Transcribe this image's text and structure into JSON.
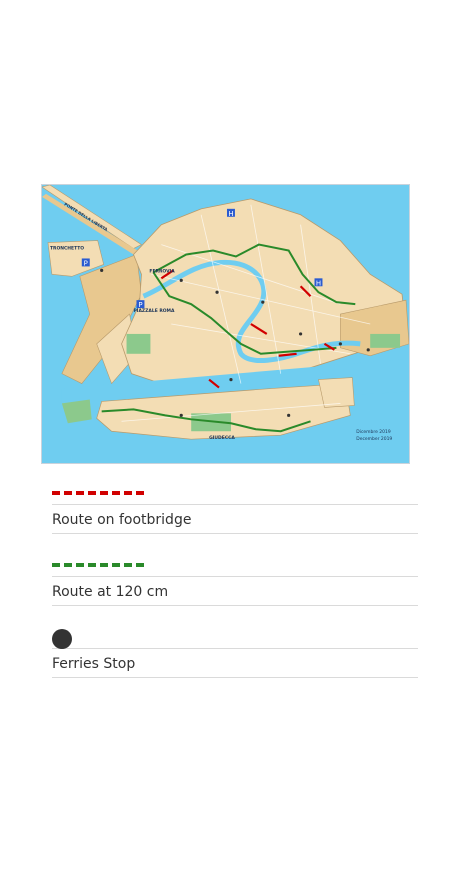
{
  "map": {
    "labels": {
      "tronchetto": "TRONCHETTO",
      "ferrovia": "FERROVIA",
      "piazzale_roma": "PIAZZALE ROMA",
      "giudecca": "GIUDECCA",
      "ponte": "PONTE DELLA LIBERTÀ",
      "date_it": "Dicembre 2019",
      "date_en": "December 2019",
      "parking_a": "P",
      "parking_b": "P",
      "h_a": "H",
      "h_b": "H"
    },
    "colors": {
      "water": "#6fcdf0",
      "land": "#f3ddb4",
      "land_dark": "#e8c88f",
      "park": "#8cc98c",
      "route_footbridge": "#d10000",
      "route_120": "#2a8a2a",
      "ferry_stop": "#333333"
    }
  },
  "legend": {
    "items": [
      {
        "label": "Route on footbridge",
        "symbol": "red-dash-line"
      },
      {
        "label": "Route at 120 cm",
        "symbol": "green-dash-line"
      },
      {
        "label": "Ferries Stop",
        "symbol": "black-dot"
      }
    ]
  }
}
